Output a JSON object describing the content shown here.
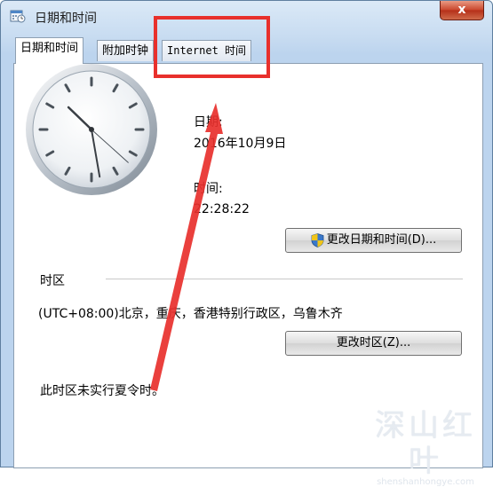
{
  "window": {
    "title": "日期和时间",
    "close_label": "x"
  },
  "tabs": [
    {
      "label": "日期和时间",
      "active": true
    },
    {
      "label": "附加时钟",
      "active": false
    },
    {
      "label": "Internet 时间",
      "active": false
    }
  ],
  "date_section": {
    "date_label": "日期:",
    "date_value": "2016年10月9日",
    "time_label": "时间:",
    "time_value": "22:28:22",
    "change_datetime_button": "更改日期和时间(D)..."
  },
  "timezone_section": {
    "heading": "时区",
    "current_timezone": "(UTC+08:00)北京，重庆，香港特别行政区，乌鲁木齐",
    "change_timezone_button": "更改时区(Z)...",
    "dst_note": "此时区未实行夏令时。"
  },
  "clock": {
    "hours": 22,
    "minutes": 28,
    "seconds": 22
  },
  "watermark": {
    "main": "深山红叶",
    "sub": "shenshanhongye.com"
  },
  "colors": {
    "annotation_red": "#e8302c",
    "title_bar": "#c8dcf1"
  }
}
